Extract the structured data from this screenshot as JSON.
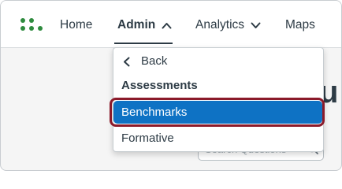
{
  "navbar": {
    "logo_icon": "canvas-studio-dots-logo",
    "brand_color": "#2e8b3e",
    "items": [
      {
        "label": "Home",
        "has_chevron": false,
        "active": false
      },
      {
        "label": "Admin",
        "has_chevron": true,
        "chevron": "chevron-up-icon",
        "active": true
      },
      {
        "label": "Analytics",
        "has_chevron": true,
        "chevron": "chevron-down-icon",
        "active": false
      },
      {
        "label": "Maps",
        "has_chevron": false,
        "active": false
      }
    ]
  },
  "dropdown": {
    "back_label": "Back",
    "section_heading": "Assessments",
    "items": [
      {
        "label": "Benchmarks",
        "selected": true
      },
      {
        "label": "Formative",
        "selected": false
      }
    ],
    "selected_color": "#0e72c4",
    "highlight_ring_color": "#8b1a2a"
  },
  "background": {
    "title_fragment": "u",
    "search_placeholder": "Search Questions"
  }
}
